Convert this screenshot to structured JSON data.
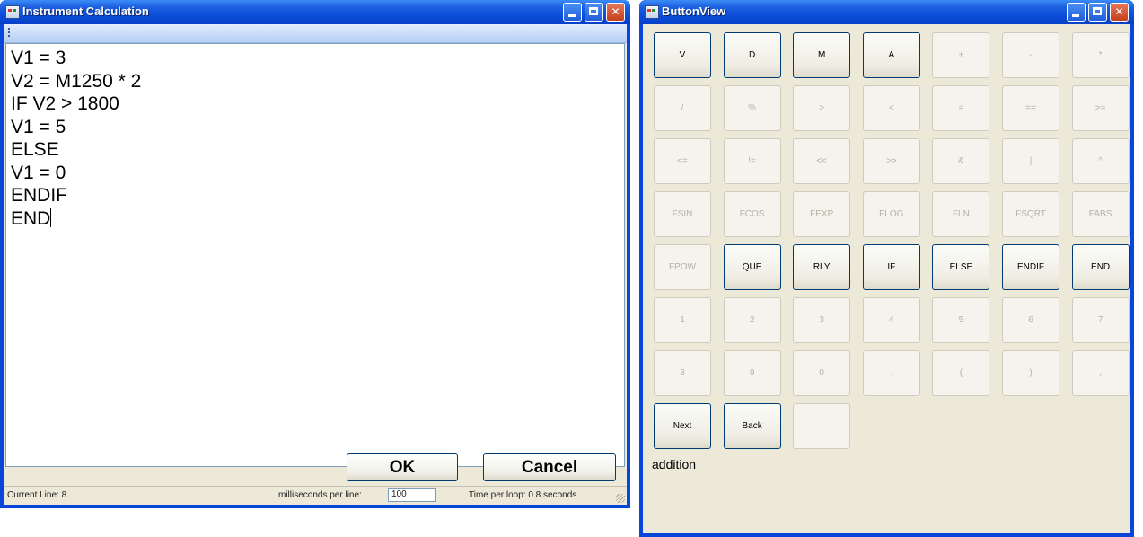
{
  "left_window": {
    "title": "Instrument Calculation",
    "code_lines": [
      "V1 = 3",
      "V2 = M1250 * 2",
      "IF V2 > 1800",
      "V1 = 5",
      "ELSE",
      "V1 = 0",
      "ENDIF",
      "END"
    ],
    "ok_label": "OK",
    "cancel_label": "Cancel",
    "status": {
      "current_line": "Current Line: 8",
      "ms_label": "milliseconds per line:",
      "ms_value": "100",
      "time_per_loop": "Time per loop: 0.8 seconds"
    }
  },
  "right_window": {
    "title": "ButtonView",
    "buttons": [
      {
        "label": "V",
        "enabled": true
      },
      {
        "label": "D",
        "enabled": true
      },
      {
        "label": "M",
        "enabled": true
      },
      {
        "label": "A",
        "enabled": true
      },
      {
        "label": "+",
        "enabled": false
      },
      {
        "label": "-",
        "enabled": false
      },
      {
        "label": "*",
        "enabled": false
      },
      {
        "label": "/",
        "enabled": false
      },
      {
        "label": "%",
        "enabled": false
      },
      {
        "label": ">",
        "enabled": false
      },
      {
        "label": "<",
        "enabled": false
      },
      {
        "label": "=",
        "enabled": false
      },
      {
        "label": "==",
        "enabled": false
      },
      {
        "label": ">=",
        "enabled": false
      },
      {
        "label": "<=",
        "enabled": false
      },
      {
        "label": "!=",
        "enabled": false
      },
      {
        "label": "<<",
        "enabled": false
      },
      {
        "label": ">>",
        "enabled": false
      },
      {
        "label": "&",
        "enabled": false
      },
      {
        "label": "|",
        "enabled": false
      },
      {
        "label": "^",
        "enabled": false
      },
      {
        "label": "FSIN",
        "enabled": false
      },
      {
        "label": "FCOS",
        "enabled": false
      },
      {
        "label": "FEXP",
        "enabled": false
      },
      {
        "label": "FLOG",
        "enabled": false
      },
      {
        "label": "FLN",
        "enabled": false
      },
      {
        "label": "FSQRT",
        "enabled": false
      },
      {
        "label": "FABS",
        "enabled": false
      },
      {
        "label": "FPOW",
        "enabled": false
      },
      {
        "label": "QUE",
        "enabled": true
      },
      {
        "label": "RLY",
        "enabled": true
      },
      {
        "label": "IF",
        "enabled": true
      },
      {
        "label": "ELSE",
        "enabled": true
      },
      {
        "label": "ENDIF",
        "enabled": true
      },
      {
        "label": "END",
        "enabled": true
      },
      {
        "label": "1",
        "enabled": false
      },
      {
        "label": "2",
        "enabled": false
      },
      {
        "label": "3",
        "enabled": false
      },
      {
        "label": "4",
        "enabled": false
      },
      {
        "label": "5",
        "enabled": false
      },
      {
        "label": "6",
        "enabled": false
      },
      {
        "label": "7",
        "enabled": false
      },
      {
        "label": "8",
        "enabled": false
      },
      {
        "label": "9",
        "enabled": false
      },
      {
        "label": "0",
        "enabled": false
      },
      {
        "label": ".",
        "enabled": false
      },
      {
        "label": "(",
        "enabled": false
      },
      {
        "label": ")",
        "enabled": false
      },
      {
        "label": ",",
        "enabled": false
      },
      {
        "label": "Next",
        "enabled": true
      },
      {
        "label": "Back",
        "enabled": true
      },
      {
        "label": "",
        "enabled": false
      }
    ],
    "hint": "addition"
  }
}
